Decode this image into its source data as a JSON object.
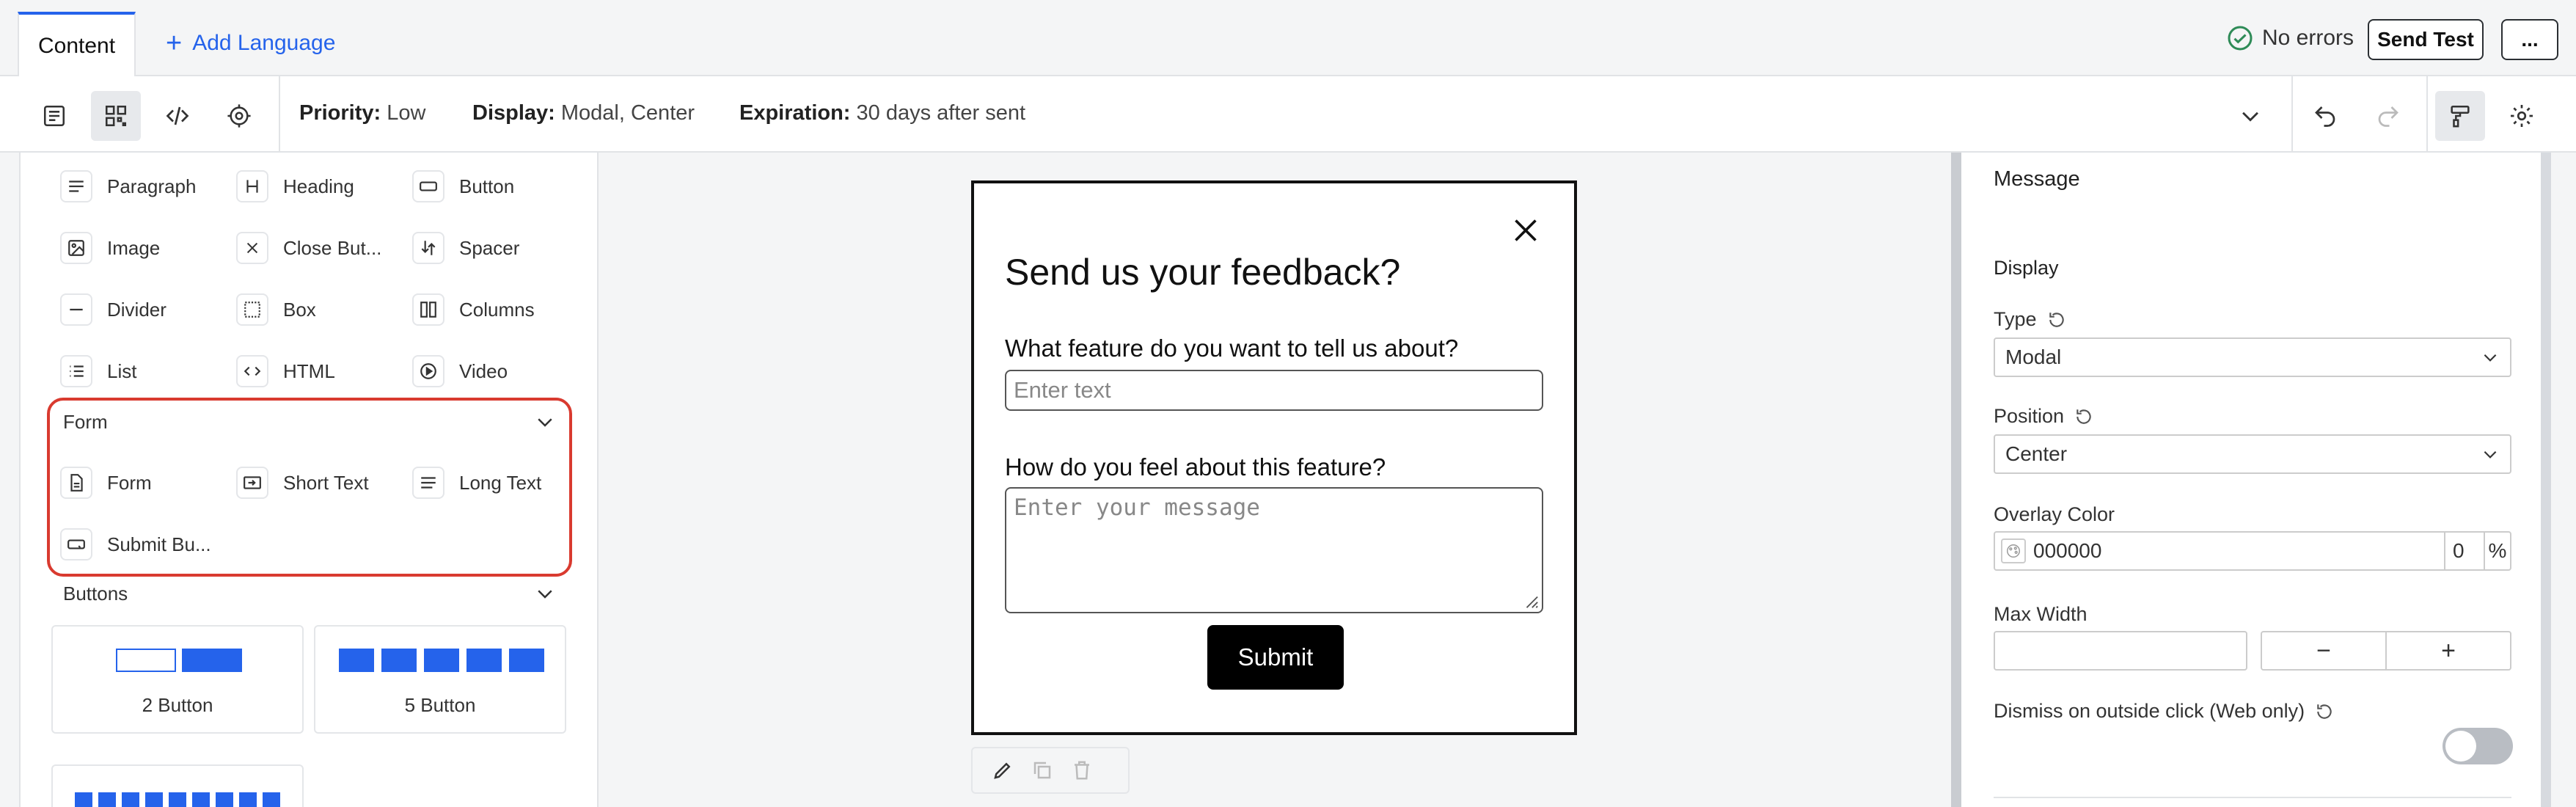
{
  "tabs": {
    "content": "Content",
    "add_language": "Add Language"
  },
  "status": {
    "no_errors": "No errors"
  },
  "actions": {
    "send_test": "Send Test",
    "more": "..."
  },
  "toolbar": {
    "priority_label": "Priority:",
    "priority_value": "Low",
    "display_label": "Display:",
    "display_value": "Modal, Center",
    "expiration_label": "Expiration:",
    "expiration_value": "30 days after sent"
  },
  "blocks": {
    "paragraph": "Paragraph",
    "heading": "Heading",
    "button": "Button",
    "image": "Image",
    "close_button": "Close But...",
    "spacer": "Spacer",
    "divider": "Divider",
    "box": "Box",
    "columns": "Columns",
    "list": "List",
    "html": "HTML",
    "video": "Video"
  },
  "form_section": {
    "title": "Form",
    "form": "Form",
    "short_text": "Short Text",
    "long_text": "Long Text",
    "submit_button": "Submit Bu..."
  },
  "buttons_section": {
    "title": "Buttons",
    "two": "2 Button",
    "five": "5 Button"
  },
  "modal": {
    "title": "Send us your feedback?",
    "q1": "What feature do you want to tell us about?",
    "q1_placeholder": "Enter text",
    "q2": "How do you feel about this feature?",
    "q2_placeholder": "Enter your message",
    "submit": "Submit"
  },
  "settings": {
    "message": "Message",
    "display": "Display",
    "type_label": "Type",
    "type_value": "Modal",
    "position_label": "Position",
    "position_value": "Center",
    "overlay_label": "Overlay Color",
    "overlay_value": "000000",
    "overlay_opacity": "0",
    "percent": "%",
    "max_width_label": "Max Width",
    "minus": "−",
    "plus": "+",
    "dismiss_label": "Dismiss on outside click (Web only)",
    "dismiss_enabled": false
  },
  "colors": {
    "accent": "#2563eb",
    "highlight": "#d93a2f"
  }
}
